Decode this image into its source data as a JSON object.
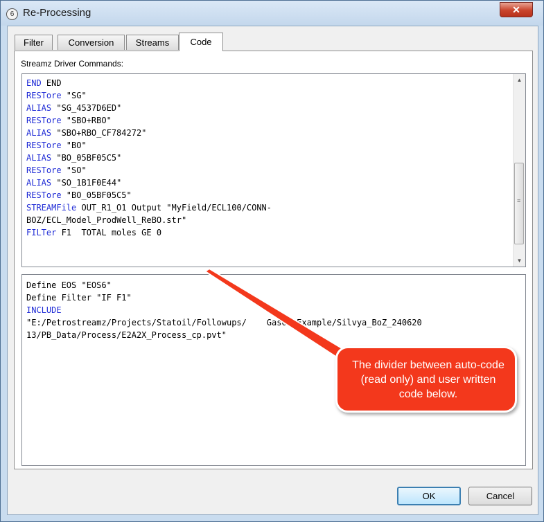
{
  "window": {
    "title": "Re-Processing",
    "app_icon": "6",
    "close_glyph": "✕"
  },
  "tabs": [
    {
      "label": "Filter"
    },
    {
      "label": "Conversion"
    },
    {
      "label": "Streams"
    },
    {
      "label": "Code",
      "selected": true
    }
  ],
  "panel": {
    "label": "Streamz Driver Commands:"
  },
  "auto_code": {
    "lines": [
      {
        "kw": "END",
        "rest": " END"
      },
      {
        "kw": "RESTore",
        "rest": " \"SG\""
      },
      {
        "kw": "ALIAS",
        "rest": " \"SG_4537D6ED\""
      },
      {
        "kw": "RESTore",
        "rest": " \"SBO+RBO\""
      },
      {
        "kw": "ALIAS",
        "rest": " \"SBO+RBO_CF784272\""
      },
      {
        "kw": "RESTore",
        "rest": " \"BO\""
      },
      {
        "kw": "ALIAS",
        "rest": " \"BO_05BF05C5\""
      },
      {
        "kw": "RESTore",
        "rest": " \"SO\""
      },
      {
        "kw": "ALIAS",
        "rest": " \"SO_1B1F0E44\""
      },
      {
        "kw": "RESTore",
        "rest": " \"BO_05BF05C5\""
      },
      {
        "kw": "STREAMFile",
        "rest": " OUT_R1_O1 Output \"MyField/ECL100/CONN-"
      },
      {
        "kw": "",
        "rest": "BOZ/ECL_Model_ProdWell_ReBO.str\""
      },
      {
        "kw": "FILTer",
        "rest": " F1  TOTAL moles GE 0"
      }
    ]
  },
  "user_code": {
    "lines": [
      {
        "kw": "",
        "rest": "Define EOS \"EOS6\""
      },
      {
        "kw": "",
        "rest": "Define Filter \"IF F1\""
      },
      {
        "kw": "INCLUDE",
        "rest": ""
      },
      {
        "kw": "",
        "rest": "\"E:/Petrostreamz/Projects/Statoil/Followups/    GasOilExample/Silvya_BoZ_240620"
      },
      {
        "kw": "",
        "rest": "13/PB_Data/Process/E2A2X_Process_cp.pvt\""
      }
    ]
  },
  "buttons": {
    "ok": "OK",
    "cancel": "Cancel"
  },
  "annotation": {
    "text": "The divider between auto-code (read only) and user written code below."
  },
  "colors": {
    "keyword": "#1f2bd6",
    "callout": "#f3381c",
    "default_button_border": "#3c7fb1"
  }
}
